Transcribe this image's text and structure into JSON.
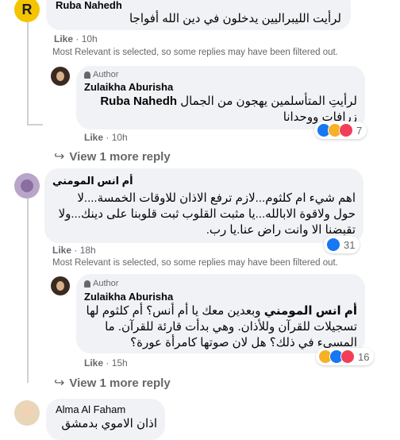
{
  "comments": [
    {
      "author": "Ruba Nahedh",
      "text": "لرأيت الليبراليين يدخلون في دين الله أفواجا",
      "like_label": "Like",
      "time": "10h",
      "filter_note": "Most Relevant is selected, so some replies may have been filtered out."
    },
    {
      "author_badge": "Author",
      "author": "Zulaikha Aburisha",
      "mention": "Ruba Nahedh",
      "text_line1": "لرأيتِ المتأسلمين يهجون من الجمال",
      "text_line2": "زرافاتٍ ووحدانا",
      "like_label": "Like",
      "time": "10h",
      "reaction_count": "7",
      "reactions": [
        "like",
        "love",
        "haha"
      ]
    },
    {
      "view_more": "View 1 more reply"
    },
    {
      "author": "أم انس المومني",
      "text": "اهم شيء ام كلثوم...لازم ترفع الاذان للاوقات الخمسة....لا حول ولاقوة الابالله...يا مثبت القلوب ثبت قلوبنا على دينك...ولا تقبضنا الا وانت راض عنا.يا رب.",
      "like_label": "Like",
      "time": "18h",
      "reaction_count": "31",
      "reactions": [
        "like"
      ],
      "filter_note": "Most Relevant is selected, so some replies may have been filtered out."
    },
    {
      "author_badge": "Author",
      "author": "Zulaikha Aburisha",
      "mention": "أم انس المومني",
      "text": "وبعدين معك يا أم أنس؟ أم كلثوم لها تسجيلات للقرآن وللأذان. وهي بدأت قارئة للقرآن. ما المسيء في ذلك؟ هل لان صوتها كامرأة عورة؟",
      "like_label": "Like",
      "time": "15h",
      "reaction_count": "16",
      "reactions": [
        "haha",
        "like",
        "love"
      ]
    },
    {
      "view_more": "View 1 more reply"
    },
    {
      "author": "Alma Al Faham",
      "text": "اذان الاموي بدمشق"
    }
  ],
  "colors": {
    "bubble": "#f0f2f5",
    "meta_text": "#65676b",
    "like_blue": "#1877f2",
    "love_red": "#f33e58",
    "haha_yellow": "#f7b125"
  }
}
